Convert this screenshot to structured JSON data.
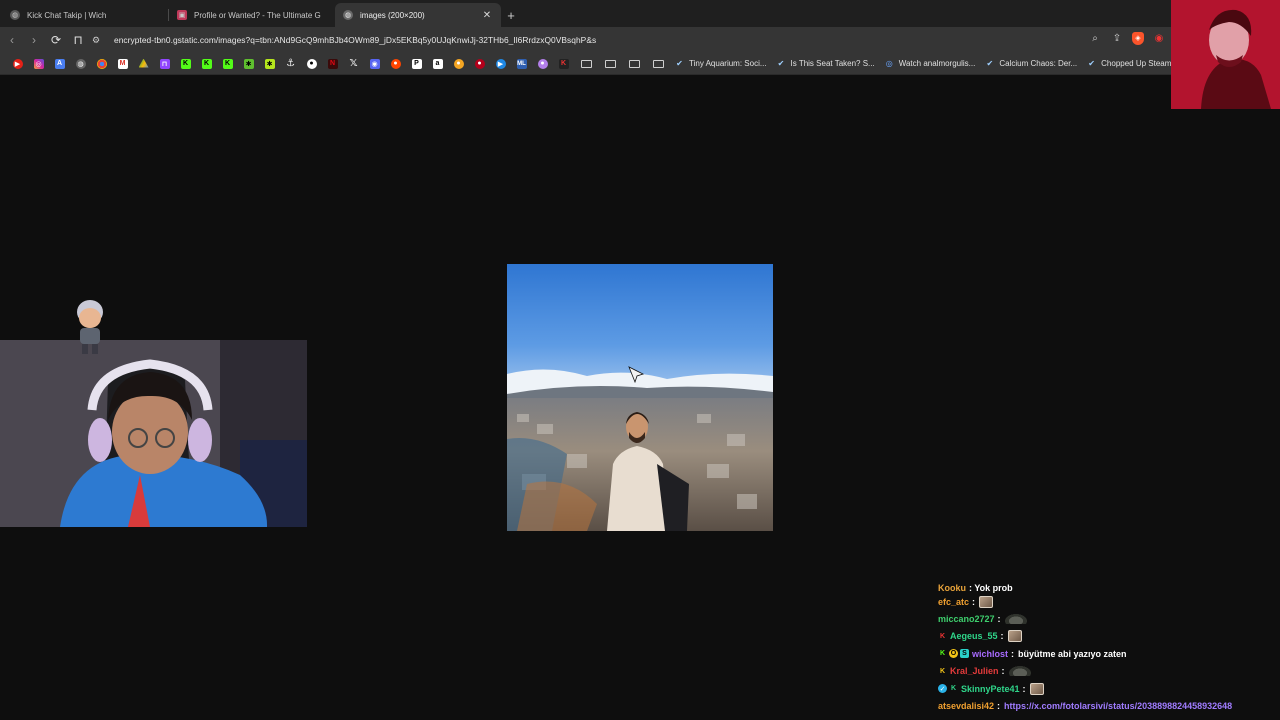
{
  "tabs": [
    {
      "title": "Kick Chat Takip | Wich",
      "active": false
    },
    {
      "title": "Profile or Wanted? - The Ultimate G",
      "active": false
    },
    {
      "title": "images (200×200)",
      "active": true
    }
  ],
  "toolbar": {
    "url": "encrypted-tbn0.gstatic.com/images?q=tbn:ANd9GcQ9mhBJb4OWm89_jDx5EKBq5y0UJqKnwiJj-32THb6_Il6RrdzxQ0VBsqhP&s"
  },
  "bookmarks": {
    "items": [
      "Tiny Aquarium: Soci...",
      "Is This Seat Taken? S...",
      "Watch analmorgulis...",
      "Calcium Chaos: Der...",
      "Chopped Up Steam"
    ]
  },
  "chat": {
    "lines": [
      {
        "user": "Kooku",
        "user_color": "#e8a33a",
        "text": ": Yok prob",
        "cut": true
      },
      {
        "user": "efc_atc",
        "user_color": "#f0a030",
        "emote": "box"
      },
      {
        "user": "miccano2727",
        "user_color": "#3ecf6d",
        "emote": "hat"
      },
      {
        "user": "Aegeus_55",
        "user_color": "#2fd58a",
        "badges": [
          "K"
        ],
        "emote": "box"
      },
      {
        "user": "wichlost",
        "user_color": "#a86bff",
        "badges": [
          "K",
          "O",
          "S"
        ],
        "text": "büyütme abi yazıyo zaten"
      },
      {
        "user": "Kral_Julien",
        "user_color": "#e33b3b",
        "badges": [
          "K"
        ],
        "emote": "hat"
      },
      {
        "user": "SkinnyPete41",
        "user_color": "#2fd58a",
        "badges": [
          "V",
          "K"
        ],
        "emote": "box"
      },
      {
        "user": "atsevdalisi42",
        "user_color": "#f0a030",
        "link": "https://x.com/fotolarsivi/status/2038898824458932648"
      }
    ]
  },
  "colors": {
    "background": "#0e0e0e",
    "toolbar": "#353535",
    "tabstrip": "#1f1f1f",
    "link": "#8ab4f8"
  }
}
